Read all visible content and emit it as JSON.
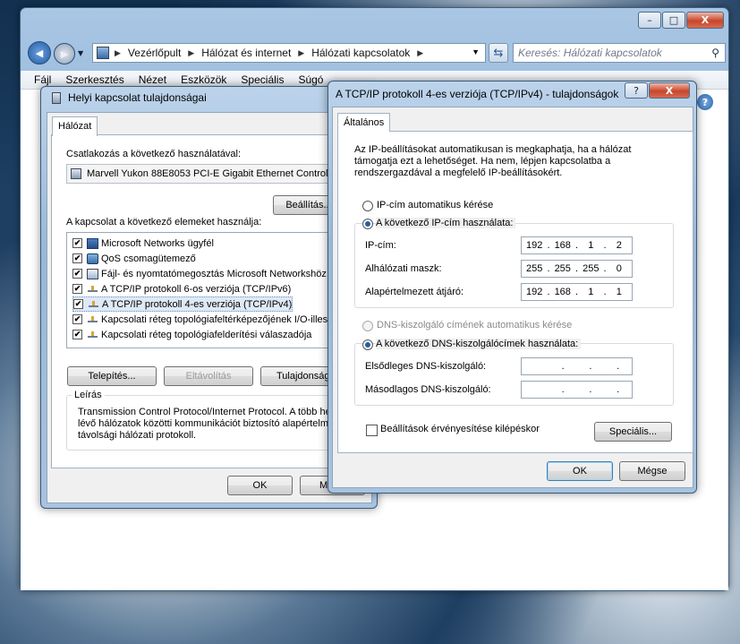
{
  "explorer": {
    "address_crumbs": [
      "Vezérlőpult",
      "Hálózat és internet",
      "Hálózati kapcsolatok"
    ],
    "search_placeholder": "Keresés: Hálózati kapcsolatok",
    "menu": [
      "Fájl",
      "Szerkesztés",
      "Nézet",
      "Eszközök",
      "Speciális",
      "Súgó"
    ],
    "buttons": {
      "minimize": "–",
      "maximize": "□",
      "close": "X"
    }
  },
  "local_dialog": {
    "title": "Helyi kapcsolat tulajdonságai",
    "tab": "Hálózat",
    "connect_using_label": "Csatlakozás a következő használatával:",
    "adapter": "Marvell Yukon 88E8053 PCI-E Gigabit Ethernet Controll",
    "configure_button": "Beállítás...",
    "items_label": "A kapcsolat a következő elemeket használja:",
    "items": [
      {
        "label": "Microsoft Networks ügyfél",
        "checked": true,
        "icon": "network-client-icon"
      },
      {
        "label": "QoS csomagütemező",
        "checked": true,
        "icon": "qos-icon"
      },
      {
        "label": "Fájl- és nyomtatómegosztás Microsoft Networkshöz",
        "checked": true,
        "icon": "share-icon"
      },
      {
        "label": "A TCP/IP protokoll 6-os verziója (TCP/IPv6)",
        "checked": true,
        "icon": "protocol-icon"
      },
      {
        "label": "A TCP/IP protokoll 4-es verziója (TCP/IPv4)",
        "checked": true,
        "icon": "protocol-icon",
        "selected": true
      },
      {
        "label": "Kapcsolati réteg topológiafeltérképezőjének I/O-illesz",
        "checked": true,
        "icon": "protocol-icon"
      },
      {
        "label": "Kapcsolati réteg topológiafelderítési válaszadója",
        "checked": true,
        "icon": "protocol-icon"
      }
    ],
    "install_button": "Telepítés...",
    "uninstall_button": "Eltávolítás",
    "properties_button": "Tulajdonság",
    "description_label": "Leírás",
    "description_lines": [
      "Transmission Control Protocol/Internet Protocol. A több hely",
      "lévő hálózatok közötti kommunikációt biztosító alapértelmez",
      "távolsági hálózati protokoll."
    ],
    "ok_button": "OK",
    "cancel_button": "Mé"
  },
  "tcp_dialog": {
    "title": "A TCP/IP protokoll 4-es verziója (TCP/IPv4) - tulajdonságok",
    "help_button": "?",
    "close_button": "X",
    "tab": "Általános",
    "intro_lines": [
      "Az IP-beállításokat automatikusan is megkaphatja, ha a hálózat",
      "támogatja ezt a lehetőséget. Ha nem, lépjen kapcsolatba a",
      "rendszergazdával a megfelelő IP-beállításokért."
    ],
    "ip_auto_label": "IP-cím automatikus kérése",
    "ip_manual_label": "A következő IP-cím használata:",
    "ip_label": "IP-cím:",
    "ip_value": [
      "192",
      "168",
      "1",
      "2"
    ],
    "mask_label": "Alhálózati maszk:",
    "mask_value": [
      "255",
      "255",
      "255",
      "0"
    ],
    "gateway_label": "Alapértelmezett átjáró:",
    "gateway_value": [
      "192",
      "168",
      "1",
      "1"
    ],
    "dns_auto_label": "DNS-kiszolgáló címének automatikus kérése",
    "dns_manual_label": "A következő DNS-kiszolgálócímek használata:",
    "dns_primary_label": "Elsődleges DNS-kiszolgáló:",
    "dns_secondary_label": "Másodlagos DNS-kiszolgáló:",
    "dns_dot": ".",
    "validate_label": "Beállítások érvényesítése kilépéskor",
    "advanced_button": "Speciális...",
    "ok_button": "OK",
    "cancel_button": "Mégse"
  }
}
